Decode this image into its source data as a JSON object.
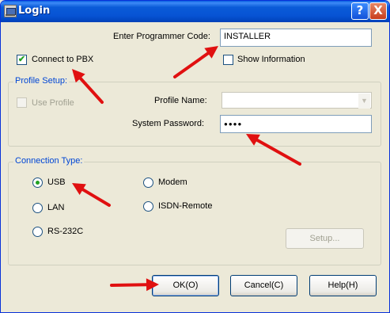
{
  "window": {
    "title": "Login"
  },
  "titlebar": {
    "help_glyph": "?",
    "close_glyph": "X"
  },
  "programmer_code": {
    "label": "Enter Programmer Code:",
    "value": "INSTALLER"
  },
  "connect_to_pbx": {
    "label": "Connect to PBX",
    "checked": true,
    "check_glyph": "✔"
  },
  "show_information": {
    "label": "Show Information",
    "checked": false
  },
  "profile_setup": {
    "title": "Profile Setup:",
    "use_profile_label": "Use Profile",
    "profile_name_label": "Profile Name:",
    "profile_name_value": "",
    "system_password_label": "System Password:",
    "system_password_value": "●●●●"
  },
  "connection_type": {
    "title": "Connection Type:",
    "options": [
      "USB",
      "Modem",
      "LAN",
      "ISDN-Remote",
      "RS-232C"
    ],
    "selected": "USB",
    "setup_label": "Setup..."
  },
  "buttons": {
    "ok": "OK(O)",
    "cancel": "Cancel(C)",
    "help": "Help(H)"
  },
  "annotation_color": "#e01010"
}
